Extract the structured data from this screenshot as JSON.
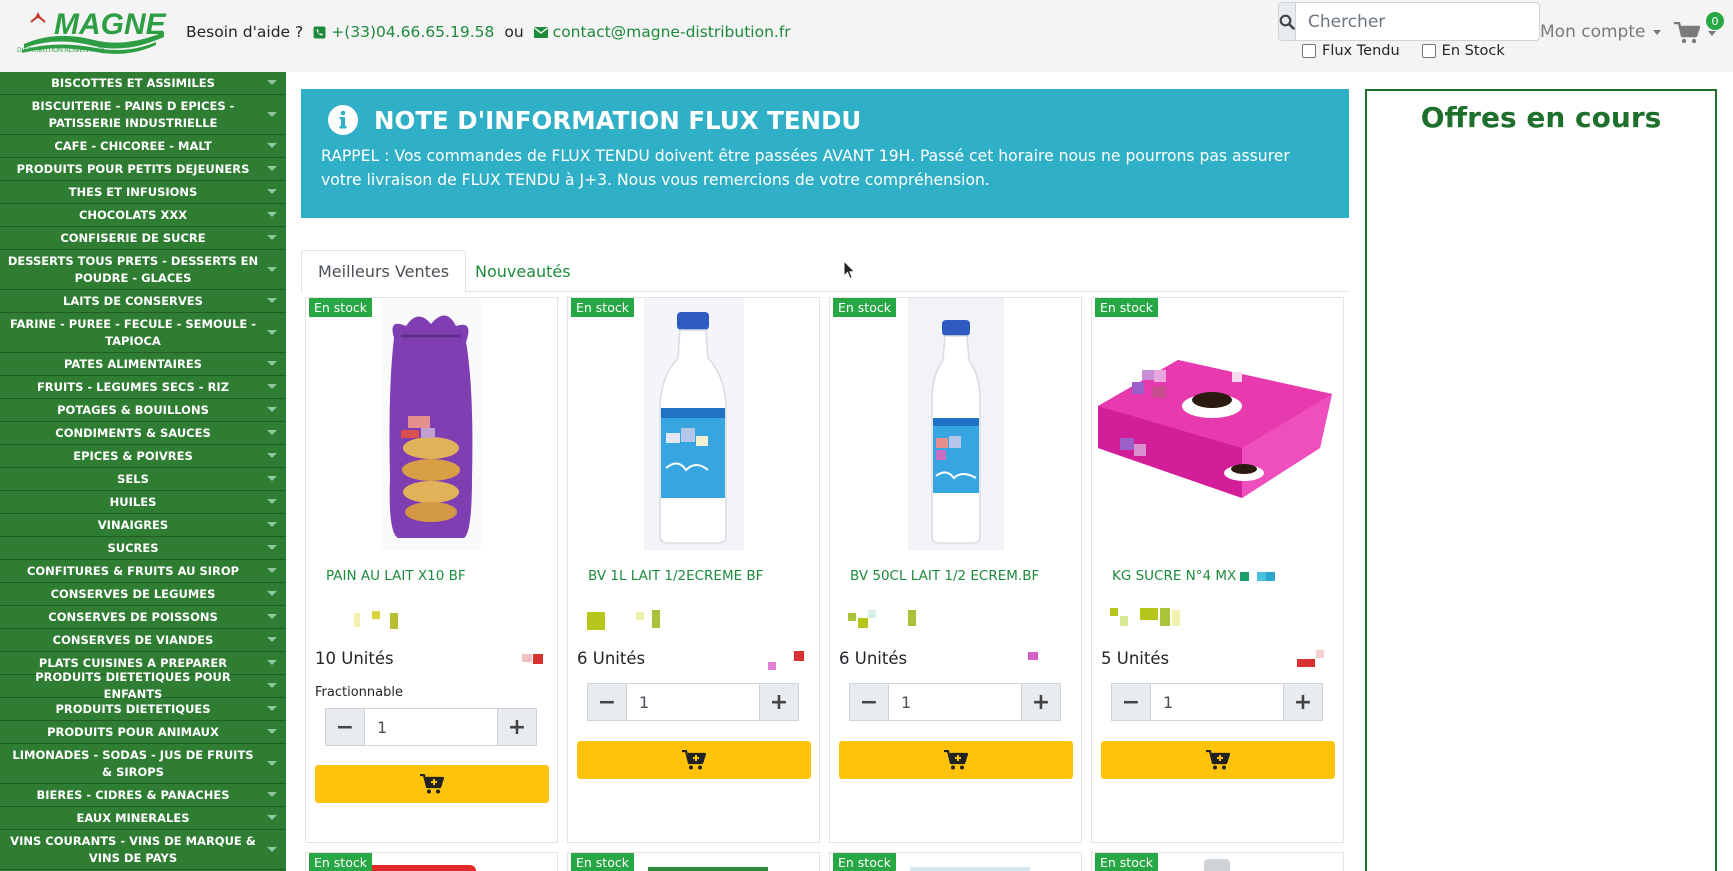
{
  "header": {
    "help_label": "Besoin d'aide ?",
    "phone": "+(33)04.66.65.19.58",
    "or_label": "ou",
    "email": "contact@magne-distribution.fr",
    "search_placeholder": "Chercher",
    "filters": [
      "Flux Tendu",
      "En Stock"
    ],
    "account_label": "Mon compte",
    "cart_count": "0"
  },
  "brand": {
    "logo_text": "MAGNE",
    "logo_subtext": "DISTRIBUTION ALIMENTAIRE",
    "primary_color": "#2e7d32",
    "accent_color": "#fec30a",
    "info_color": "#2fb0c6"
  },
  "sidebar": {
    "items": [
      "BISCOTTES ET ASSIMILES",
      "BISCUITERIE - PAINS D EPICES - PATISSERIE INDUSTRIELLE",
      "CAFE - CHICOREE - MALT",
      "PRODUITS POUR PETITS DEJEUNERS",
      "THES ET INFUSIONS",
      "CHOCOLATS XXX",
      "CONFISERIE DE SUCRE",
      "DESSERTS TOUS PRETS - DESSERTS EN POUDRE - GLACES",
      "LAITS DE CONSERVES",
      "FARINE - PUREE - FECULE - SEMOULE - TAPIOCA",
      "PATES ALIMENTAIRES",
      "FRUITS - LEGUMES SECS - RIZ",
      "POTAGES & BOUILLONS",
      "CONDIMENTS & SAUCES",
      "EPICES & POIVRES",
      "SELS",
      "HUILES",
      "VINAIGRES",
      "SUCRES",
      "CONFITURES & FRUITS AU SIROP",
      "CONSERVES DE LEGUMES",
      "CONSERVES DE POISSONS",
      "CONSERVES DE VIANDES",
      "PLATS CUISINES A PREPARER",
      "PRODUITS DIETETIQUES POUR ENFANTS",
      "PRODUITS DIETETIQUES",
      "PRODUITS POUR ANIMAUX",
      "LIMONADES - SODAS - JUS DE FRUITS & SIROPS",
      "BIERES - CIDRES & PANACHES",
      "EAUX MINERALES",
      "VINS COURANTS - VINS DE MARQUE & VINS DE PAYS"
    ]
  },
  "alert": {
    "title": "NOTE D'INFORMATION FLUX TENDU",
    "text": "RAPPEL : Vos commandes de FLUX TENDU doivent être passées AVANT 19H. Passé cet horaire nous ne pourrons pas assurer votre livraison de FLUX TENDU à J+3. Nous vous remercions de votre compréhension."
  },
  "tabs": [
    "Meilleurs Ventes",
    "Nouveautés"
  ],
  "products": [
    {
      "badge": "En stock",
      "name": "PAIN AU LAIT X10 BF",
      "units": "10 Unités",
      "fractionnable": "Fractionnable",
      "quantity": "1",
      "image": "brioche-bag"
    },
    {
      "badge": "En stock",
      "name": "BV 1L LAIT 1/2ECREME BF",
      "units": "6 Unités",
      "quantity": "1",
      "image": "milk-bottle-1l"
    },
    {
      "badge": "En stock",
      "name": "BV 50CL LAIT 1/2 ECREM.BF",
      "units": "6 Unités",
      "quantity": "1",
      "image": "milk-bottle-50cl"
    },
    {
      "badge": "En stock",
      "name": "KG SUCRE N°4 MX",
      "units": "5 Unités",
      "quantity": "1",
      "image": "sugar-box"
    }
  ],
  "products_row2": [
    {
      "badge": "En stock"
    },
    {
      "badge": "En stock"
    },
    {
      "badge": "En stock"
    },
    {
      "badge": "En stock"
    }
  ],
  "offers": {
    "title": "Offres en cours"
  }
}
